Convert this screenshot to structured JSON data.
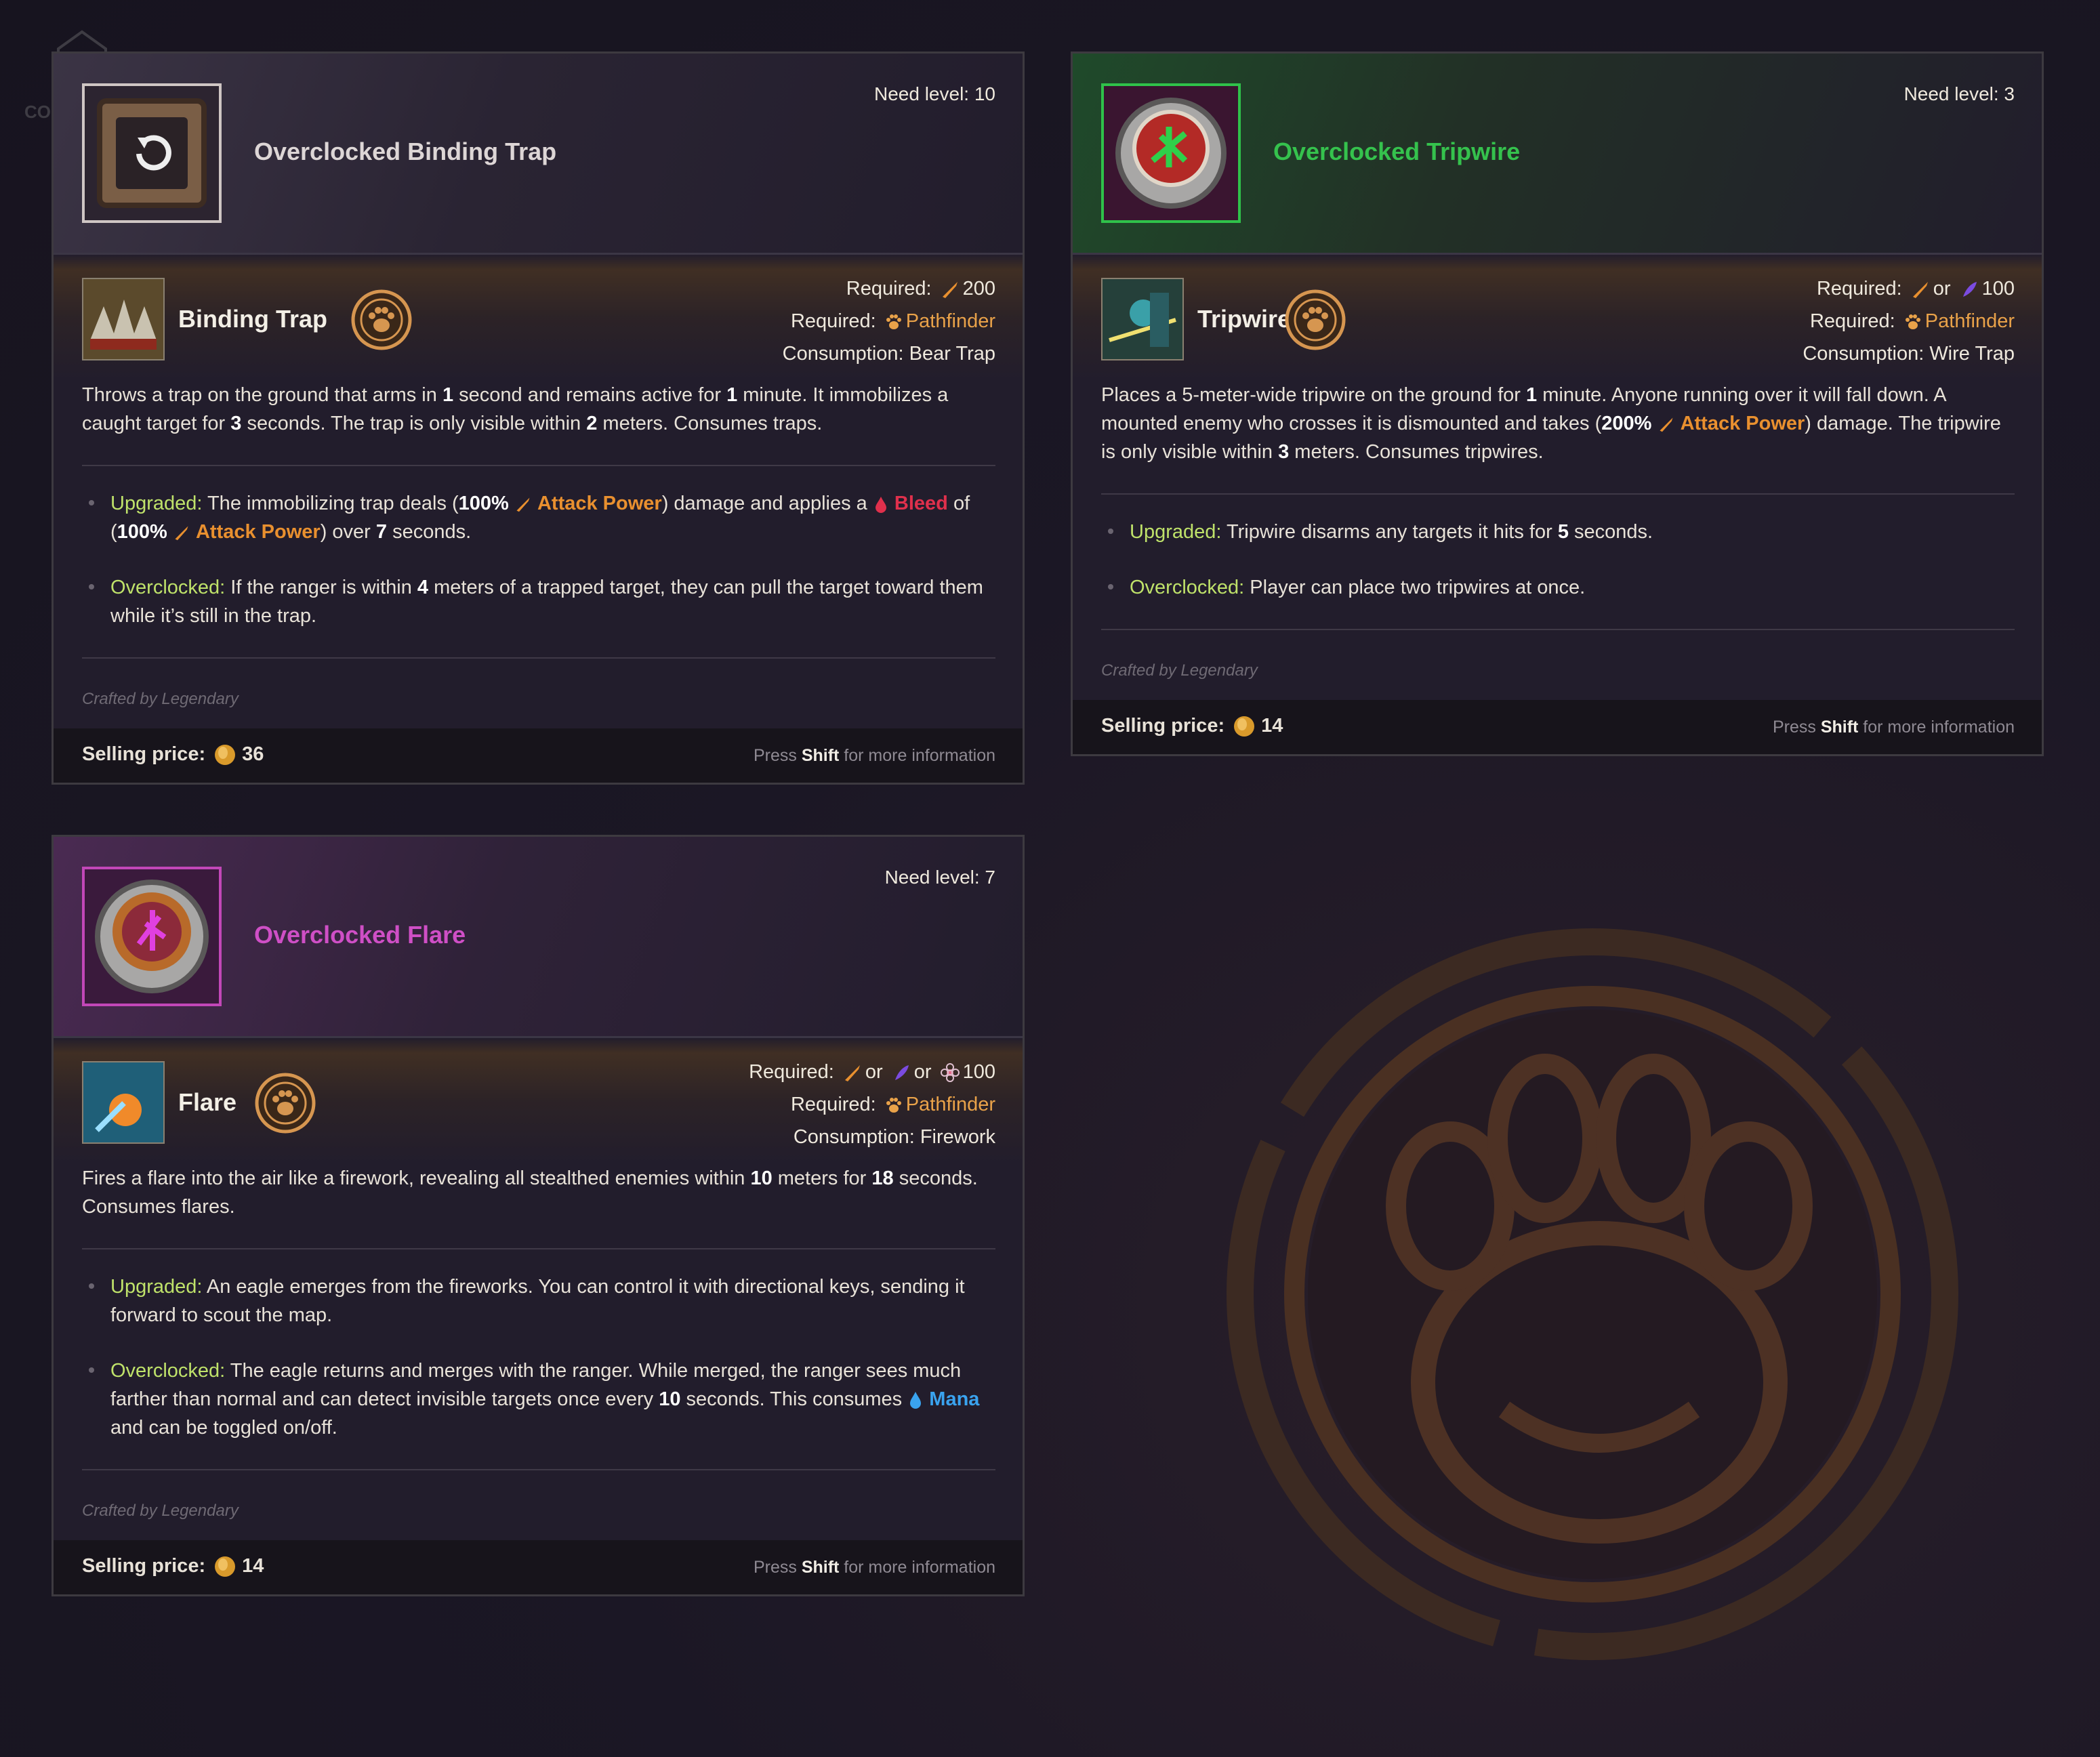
{
  "watermark": "COREPLAY",
  "colors": {
    "accent_orange": "#e9a249",
    "upgraded_label": "#bfe26a",
    "bleed": "#e0304c",
    "mana": "#3aa3ef",
    "tripwire_title": "#35c24d",
    "flare_title": "#cf4fc6"
  },
  "cards": [
    {
      "title": "Overclocked Binding Trap",
      "need_level": "Need level: 10",
      "skill_name": "Binding Trap",
      "req1_label": "Required:",
      "req1_value": "200",
      "req2_label": "Required:",
      "req2_value": "Pathfinder",
      "consumption": "Consumption: Bear Trap",
      "desc_1": "Throws a trap on the ground that arms in ",
      "desc_n1": "1",
      "desc_2": " second and remains active for ",
      "desc_n2": "1",
      "desc_3": " minute. It immobilizes a caught target for ",
      "desc_n3": "3",
      "desc_4": " seconds. The trap is only visible within ",
      "desc_n4": "2",
      "desc_5": " meters. Consumes traps.",
      "up_label": "Upgraded:",
      "up_1": " The immobilizing trap deals (",
      "up_pct1": "100%",
      "ap": "Attack Power",
      "up_2": ") damage and applies a ",
      "bleed": "Bleed",
      "up_3": " of (",
      "up_pct2": "100%",
      "up_4": ") over ",
      "up_n": "7",
      "up_5": " seconds.",
      "oc_label": "Overclocked:",
      "oc_1": " If the ranger is within ",
      "oc_n": "4",
      "oc_2": " meters of a trapped target, they can pull the target toward them while it’s still in the trap.",
      "crafted": "Crafted by Legendary",
      "sell_label": "Selling price:",
      "price": "36",
      "shift_pre": "Press ",
      "shift_key": "Shift",
      "shift_post": " for more information"
    },
    {
      "title": "Overclocked Tripwire",
      "need_level": "Need level: 3",
      "skill_name": "Tripwire",
      "req1_label": "Required:",
      "req1_or": "or",
      "req1_value": "100",
      "req2_label": "Required:",
      "req2_value": "Pathfinder",
      "consumption": "Consumption: Wire Trap",
      "desc_1": "Places a 5-meter-wide tripwire on the ground for ",
      "desc_n1": "1",
      "desc_2": " minute. Anyone running over it will fall down. A mounted enemy who crosses it is dismounted and takes (",
      "desc_pct": "200%",
      "ap": "Attack Power",
      "desc_3": ") damage. The tripwire is only visible within ",
      "desc_n2": "3",
      "desc_4": " meters. Consumes tripwires.",
      "up_label": "Upgraded:",
      "up_1": " Tripwire disarms any targets it hits for ",
      "up_n": "5",
      "up_2": " seconds.",
      "oc_label": "Overclocked:",
      "oc_1": " Player can place two tripwires at once.",
      "crafted": "Crafted by Legendary",
      "sell_label": "Selling price:",
      "price": "14",
      "shift_pre": "Press ",
      "shift_key": "Shift",
      "shift_post": " for more information"
    },
    {
      "title": "Overclocked Flare",
      "need_level": "Need level: 7",
      "skill_name": "Flare",
      "req1_label": "Required:",
      "req1_or1": "or",
      "req1_or2": "or",
      "req1_value": "100",
      "req2_label": "Required:",
      "req2_value": "Pathfinder",
      "consumption": "Consumption: Firework",
      "desc_1": "Fires a flare into the air like a firework, revealing all stealthed enemies within ",
      "desc_n1": "10",
      "desc_2": " meters for ",
      "desc_n2": "18",
      "desc_3": " seconds. Consumes flares.",
      "up_label": "Upgraded:",
      "up_1": " An eagle emerges from the fireworks. You can control it with directional keys, sending it forward to scout the map.",
      "oc_label": "Overclocked:",
      "oc_1": " The eagle returns and merges with the ranger. While merged, the ranger sees much farther than normal and can detect invisible targets once every ",
      "oc_n": "10",
      "oc_2": " seconds. This consumes ",
      "mana": "Mana",
      "oc_3": " and can be toggled on/off.",
      "crafted": "Crafted by Legendary",
      "sell_label": "Selling price:",
      "price": "14",
      "shift_pre": "Press ",
      "shift_key": "Shift",
      "shift_post": " for more information"
    }
  ]
}
